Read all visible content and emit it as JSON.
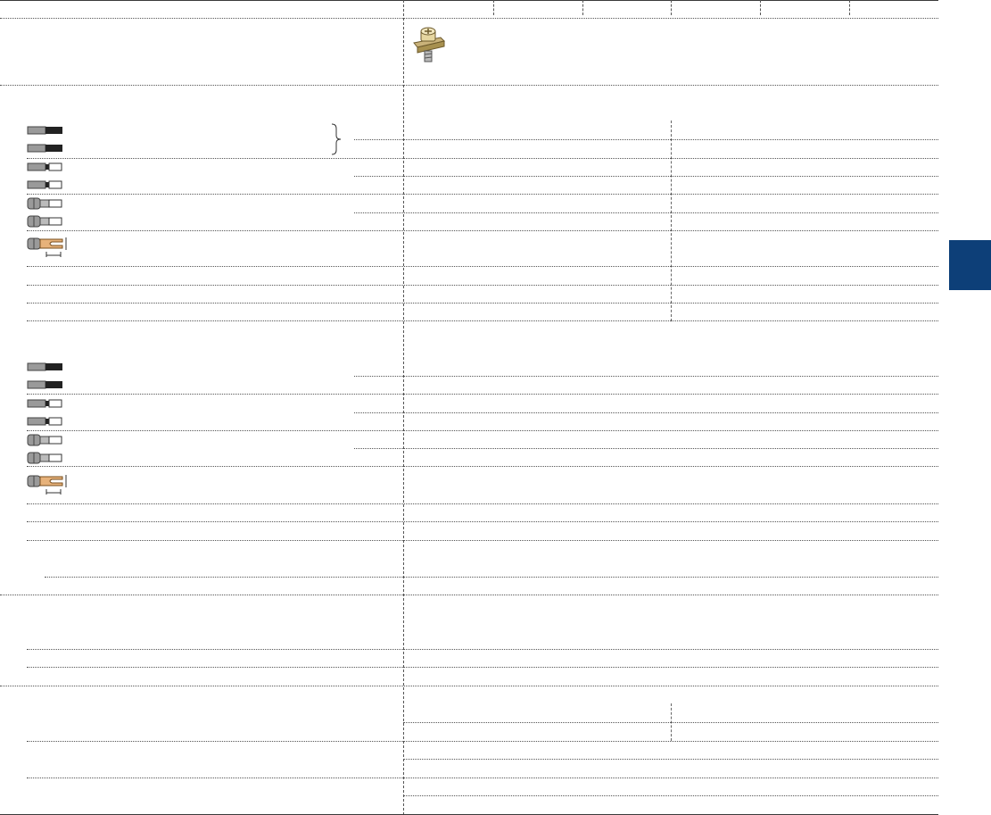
{
  "page": {},
  "side_tab": {
    "color": "#0d3f78"
  },
  "icons": {
    "terminal_screw": "terminal-screw-icon",
    "wire_solid": "solid-wire-icon",
    "wire_stranded": "stranded-wire-icon",
    "wire_ferrule_plain": "ferrule-plain-icon",
    "wire_ferrule_insulated": "ferrule-insulated-icon",
    "fork_lug": "fork-lug-icon"
  },
  "colors": {
    "fork_lug": "#e7b27a",
    "wire_dark": "#222222"
  }
}
